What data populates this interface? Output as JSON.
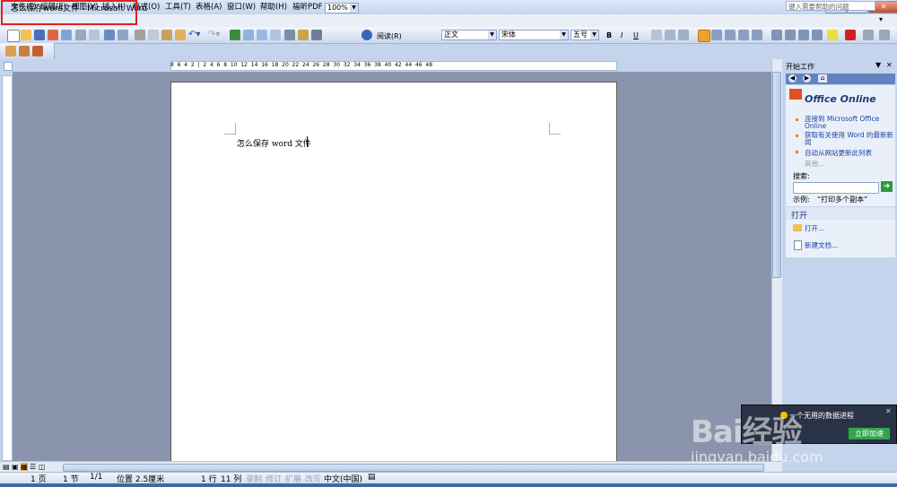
{
  "window": {
    "title": "怎么保存word文件 - Microsoft Word"
  },
  "menu": {
    "items": [
      "文件(F)",
      "编辑(E)",
      "视图(V)",
      "插入(I)",
      "格式(O)",
      "工具(T)",
      "表格(A)",
      "窗口(W)",
      "帮助(H)",
      "福昕PDF"
    ],
    "help_placeholder": "键入需要帮助的问题"
  },
  "toolbar": {
    "zoom": "100%",
    "read_label": "阅读(R)",
    "style": "正文",
    "font": "宋体",
    "size": "五号",
    "bold": "B",
    "italic": "I",
    "underline": "U"
  },
  "ruler": {
    "ticks": "8  6  4  2  |  2  4  6  8  10  12  14  16  18  20  22  24  26  28  30  32  34  36  38  40  42  44  46  48"
  },
  "document": {
    "text": "怎么保存 word 文件"
  },
  "task_pane": {
    "title": "开始工作",
    "logo": "Office Online",
    "links": [
      "连接到 Microsoft Office Online",
      "获取有关使用 Word 的最新新闻",
      "自动从网站更新此列表"
    ],
    "more": "其他...",
    "search_label": "搜索:",
    "example_label": "示例:",
    "example_value": "“打印多个副本”",
    "open_section": "打开",
    "open_link": "打开...",
    "new_doc_link": "新建文档..."
  },
  "notification": {
    "text": "一个无用的数据进程",
    "button": "立即加速"
  },
  "watermark": {
    "brand": "Bai经验",
    "url": "jingyan.baidu.com"
  },
  "status": {
    "page": "1 页",
    "section": "1 节",
    "pages": "1/1",
    "position": "位置 2.5厘米",
    "line": "1 行",
    "column": "11 列",
    "rec": "录制",
    "trk": "修订",
    "ext": "扩展",
    "ovr": "改写",
    "language": "中文(中国)"
  },
  "colors": {
    "accent": "#1c3fa0",
    "highlight": "#e02020",
    "notify_button": "#2fa64a"
  }
}
